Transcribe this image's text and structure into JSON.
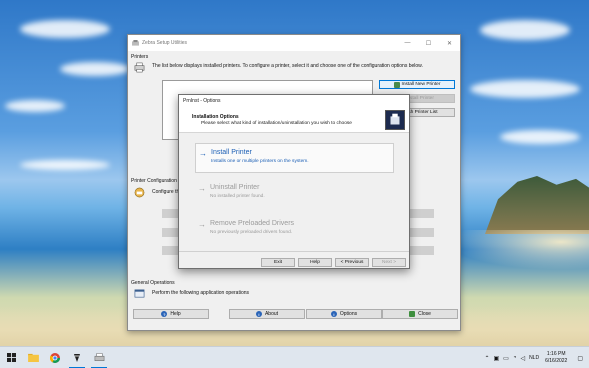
{
  "window": {
    "title": "Zebra Setup Utilities",
    "controls": {
      "minimize": "—",
      "maximize": "☐",
      "close": "✕"
    }
  },
  "printers": {
    "section": "Printers",
    "description": "The list below displays installed printers. To configure a printer, select it and choose one of the configuration options below.",
    "install_new_printer": "Install New Printer",
    "uninstall_printer": "Uninstall Printer",
    "refresh_printer_list": "Refresh Printer List"
  },
  "printer_config": {
    "section": "Printer Configuration",
    "description": "Configure the selected printer."
  },
  "general": {
    "section": "General Operations",
    "description": "Perform the following application operations"
  },
  "bottom_buttons": {
    "help": "Help",
    "about": "About",
    "options": "Options",
    "close": "Close"
  },
  "dialog": {
    "title": "PrnInst - Options",
    "header_title": "Installation Options",
    "header_subtitle": "Please select what kind of installation/uninstallation you wish to choose",
    "options": [
      {
        "title": "Install Printer",
        "description": "Installs one or multiple printers on the system.",
        "state": "active"
      },
      {
        "title": "Uninstall Printer",
        "description": "No installed printer found.",
        "state": "disabled"
      },
      {
        "title": "Remove Preloaded Drivers",
        "description": "No previously preloaded drivers found.",
        "state": "disabled"
      }
    ],
    "buttons": {
      "exit": "Exit",
      "help": "Help",
      "previous": "< Previous",
      "next": "Next >"
    }
  },
  "taskbar": {
    "language": "NLD",
    "time": "1:16 PM",
    "date": "6/16/2022"
  },
  "colors": {
    "accent": "#0078d7",
    "option_active": "#1c5fb5",
    "disabled_text": "#9a9a9a"
  }
}
